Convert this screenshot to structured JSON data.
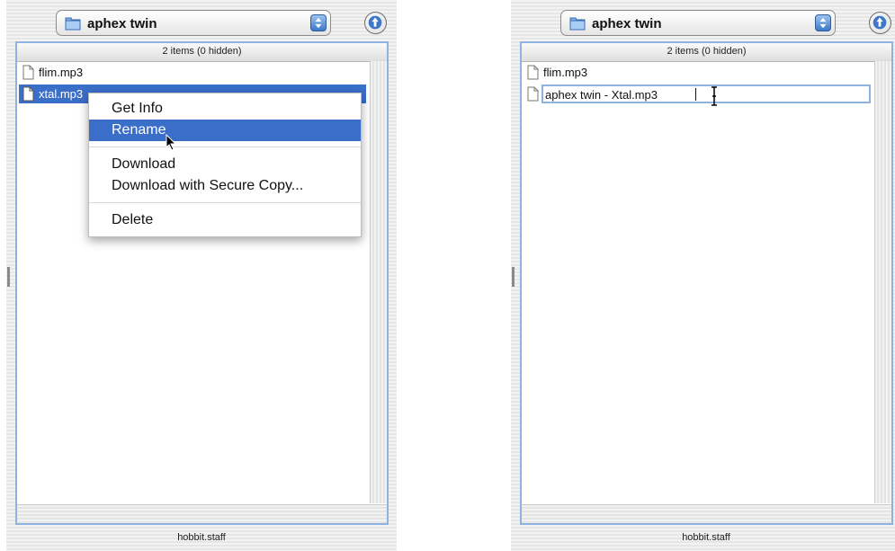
{
  "left_window": {
    "path_popup": {
      "label": "aphex twin"
    },
    "browser": {
      "header": "2 items (0 hidden)",
      "files": [
        {
          "name": "flim.mp3",
          "selected": false
        },
        {
          "name": "xtal.mp3",
          "selected": true
        }
      ]
    },
    "context_menu": {
      "items": [
        "Get Info",
        "Rename",
        "Download",
        "Download with Secure Copy...",
        "Delete"
      ],
      "highlighted": "Rename"
    },
    "status": "hobbit.staff"
  },
  "right_window": {
    "path_popup": {
      "label": "aphex twin"
    },
    "browser": {
      "header": "2 items (0 hidden)",
      "files": [
        {
          "name": "flim.mp3"
        }
      ],
      "rename_field": {
        "value": "aphex twin - Xtal.mp3"
      }
    },
    "status": "hobbit.staff"
  },
  "colors": {
    "selection": "#3a6ec9",
    "border_accent": "#8fb3e0",
    "popup_arrows": "#3d78c8"
  },
  "icons": [
    "folder-icon",
    "popup-arrows-icon",
    "go-up-icon",
    "document-icon",
    "arrow-cursor-icon",
    "ibeam-cursor-icon"
  ]
}
